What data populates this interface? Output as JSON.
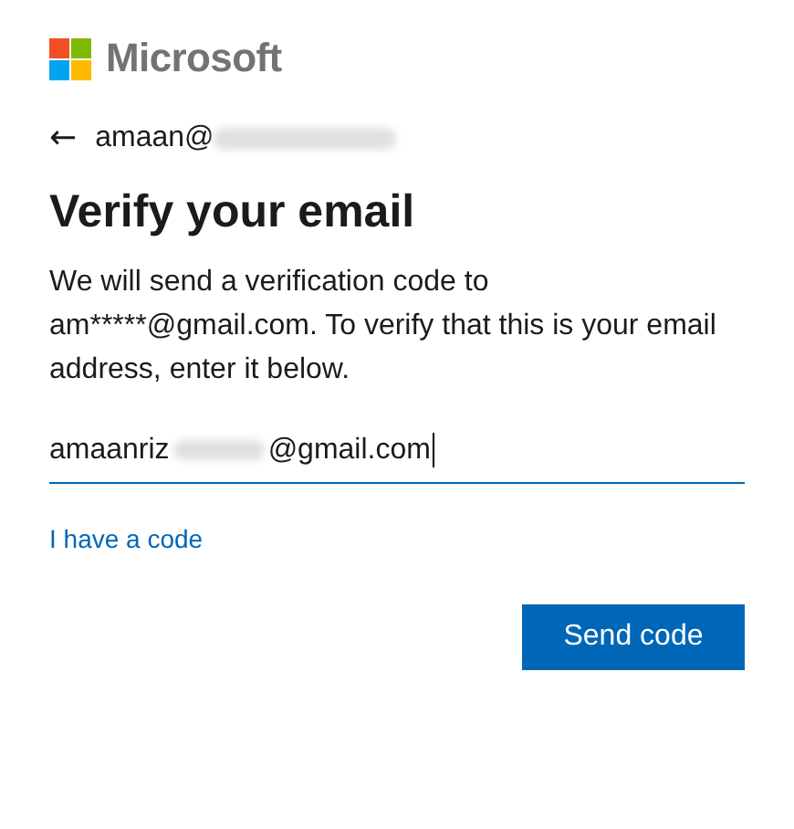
{
  "logo": {
    "text": "Microsoft"
  },
  "account": {
    "back": "←",
    "email_visible": "amaan@"
  },
  "heading": "Verify your email",
  "message": "We will send a verification code to am*****@gmail.com. To verify that this is your email address, enter it below.",
  "email_field": {
    "value_start": "amaanriz",
    "value_end": "@gmail.com"
  },
  "link": "I have a code",
  "buttons": [
    {
      "label": "Send code",
      "kind": "primary"
    }
  ]
}
